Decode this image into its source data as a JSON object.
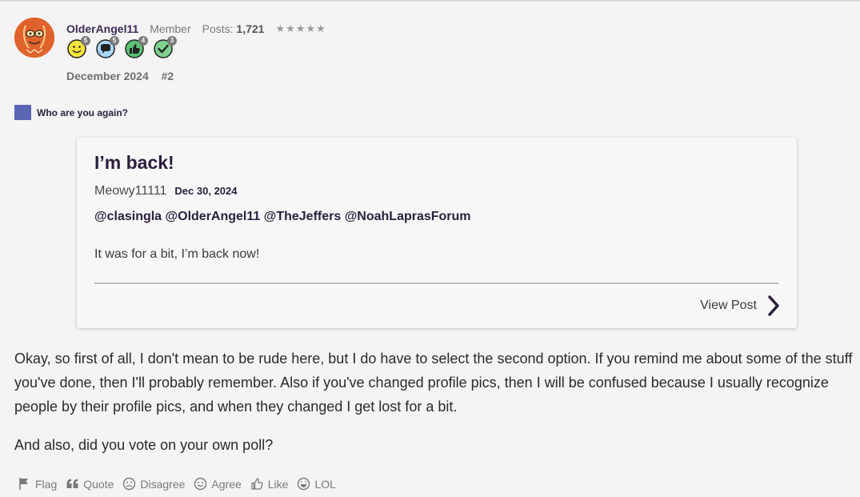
{
  "author": {
    "username": "OlderAngel11",
    "role": "Member",
    "posts_label": "Posts:",
    "posts_count": "1,721",
    "stars": "★★★★★",
    "badges": [
      {
        "icon": "smiley-badge-icon",
        "count": "5"
      },
      {
        "icon": "speech-bubble-badge-icon",
        "count": "5"
      },
      {
        "icon": "thumbs-up-badge-icon",
        "count": "4"
      },
      {
        "icon": "checkmark-badge-icon",
        "count": "3"
      }
    ]
  },
  "post_meta": {
    "date": "December 2024",
    "number": "#2"
  },
  "poll_vote": {
    "text": "Who are you again?",
    "color": "#5a66b3"
  },
  "embed": {
    "title": "I’m back!",
    "author": "Meowy11111",
    "date": "Dec 30, 2024",
    "mentions": "@clasingla @OlderAngel11 @TheJeffers @NoahLaprasForum",
    "body": "It was for a bit, I’m back now!",
    "view_post_label": "View Post"
  },
  "body": {
    "paragraph1": "Okay, so first of all, I don't mean to be rude here, but I do have to select the second option. If you remind me about some of the stuff you've done, then I'll probably remember. Also if you've changed profile pics, then I will be confused because I usually recognize people by their profile pics, and when they changed I get lost for a bit.",
    "paragraph2": "And also, did you vote on your own poll?"
  },
  "reactions": [
    {
      "label": "Flag",
      "icon": "flag-icon"
    },
    {
      "label": "Quote",
      "icon": "quote-icon"
    },
    {
      "label": "Disagree",
      "icon": "frown-icon"
    },
    {
      "label": "Agree",
      "icon": "smile-icon"
    },
    {
      "label": "Like",
      "icon": "thumbs-up-icon"
    },
    {
      "label": "LOL",
      "icon": "laugh-icon"
    }
  ]
}
